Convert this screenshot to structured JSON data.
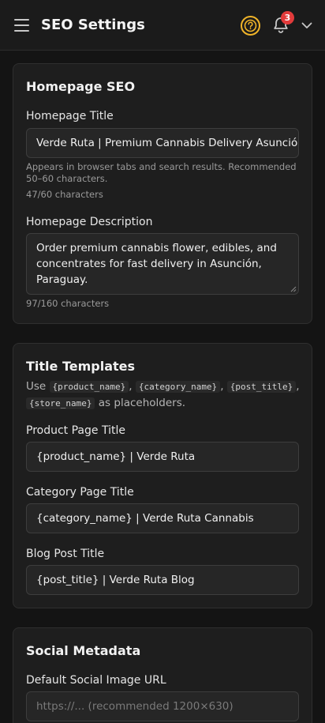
{
  "header": {
    "title": "SEO Settings",
    "notification_count": "3",
    "icons": [
      "menu-icon",
      "help-icon",
      "bell-icon",
      "chevron-down-icon"
    ],
    "accent_color": "#f0b429",
    "badge_color": "#e23b3b"
  },
  "homepage_seo": {
    "title": "Homepage SEO",
    "homepage_title_label": "Homepage Title",
    "homepage_title_value": "Verde Ruta | Premium Cannabis Delivery Asunción",
    "homepage_title_hint": "Appears in browser tabs and search results. Recommended 50–60 characters.",
    "homepage_title_count": "47/60 characters",
    "homepage_description_label": "Homepage Description",
    "homepage_description_value": "Order premium cannabis flower, edibles, and concentrates for fast delivery in Asunción, Paraguay.",
    "homepage_description_count": "97/160 characters"
  },
  "title_templates": {
    "title": "Title Templates",
    "description_use": "Use",
    "description_suffix": "as placeholders.",
    "placeholders": [
      "{product_name}",
      "{category_name}",
      "{post_title}",
      "{store_name}"
    ],
    "product_label": "Product Page Title",
    "product_value": "{product_name} | Verde Ruta",
    "category_label": "Category Page Title",
    "category_value": "{category_name} | Verde Ruta Cannabis",
    "blog_label": "Blog Post Title",
    "blog_value": "{post_title} | Verde Ruta Blog"
  },
  "social_metadata": {
    "title": "Social Metadata",
    "image_url_label": "Default Social Image URL",
    "image_url_placeholder": "https://... (recommended 1200×630)"
  }
}
